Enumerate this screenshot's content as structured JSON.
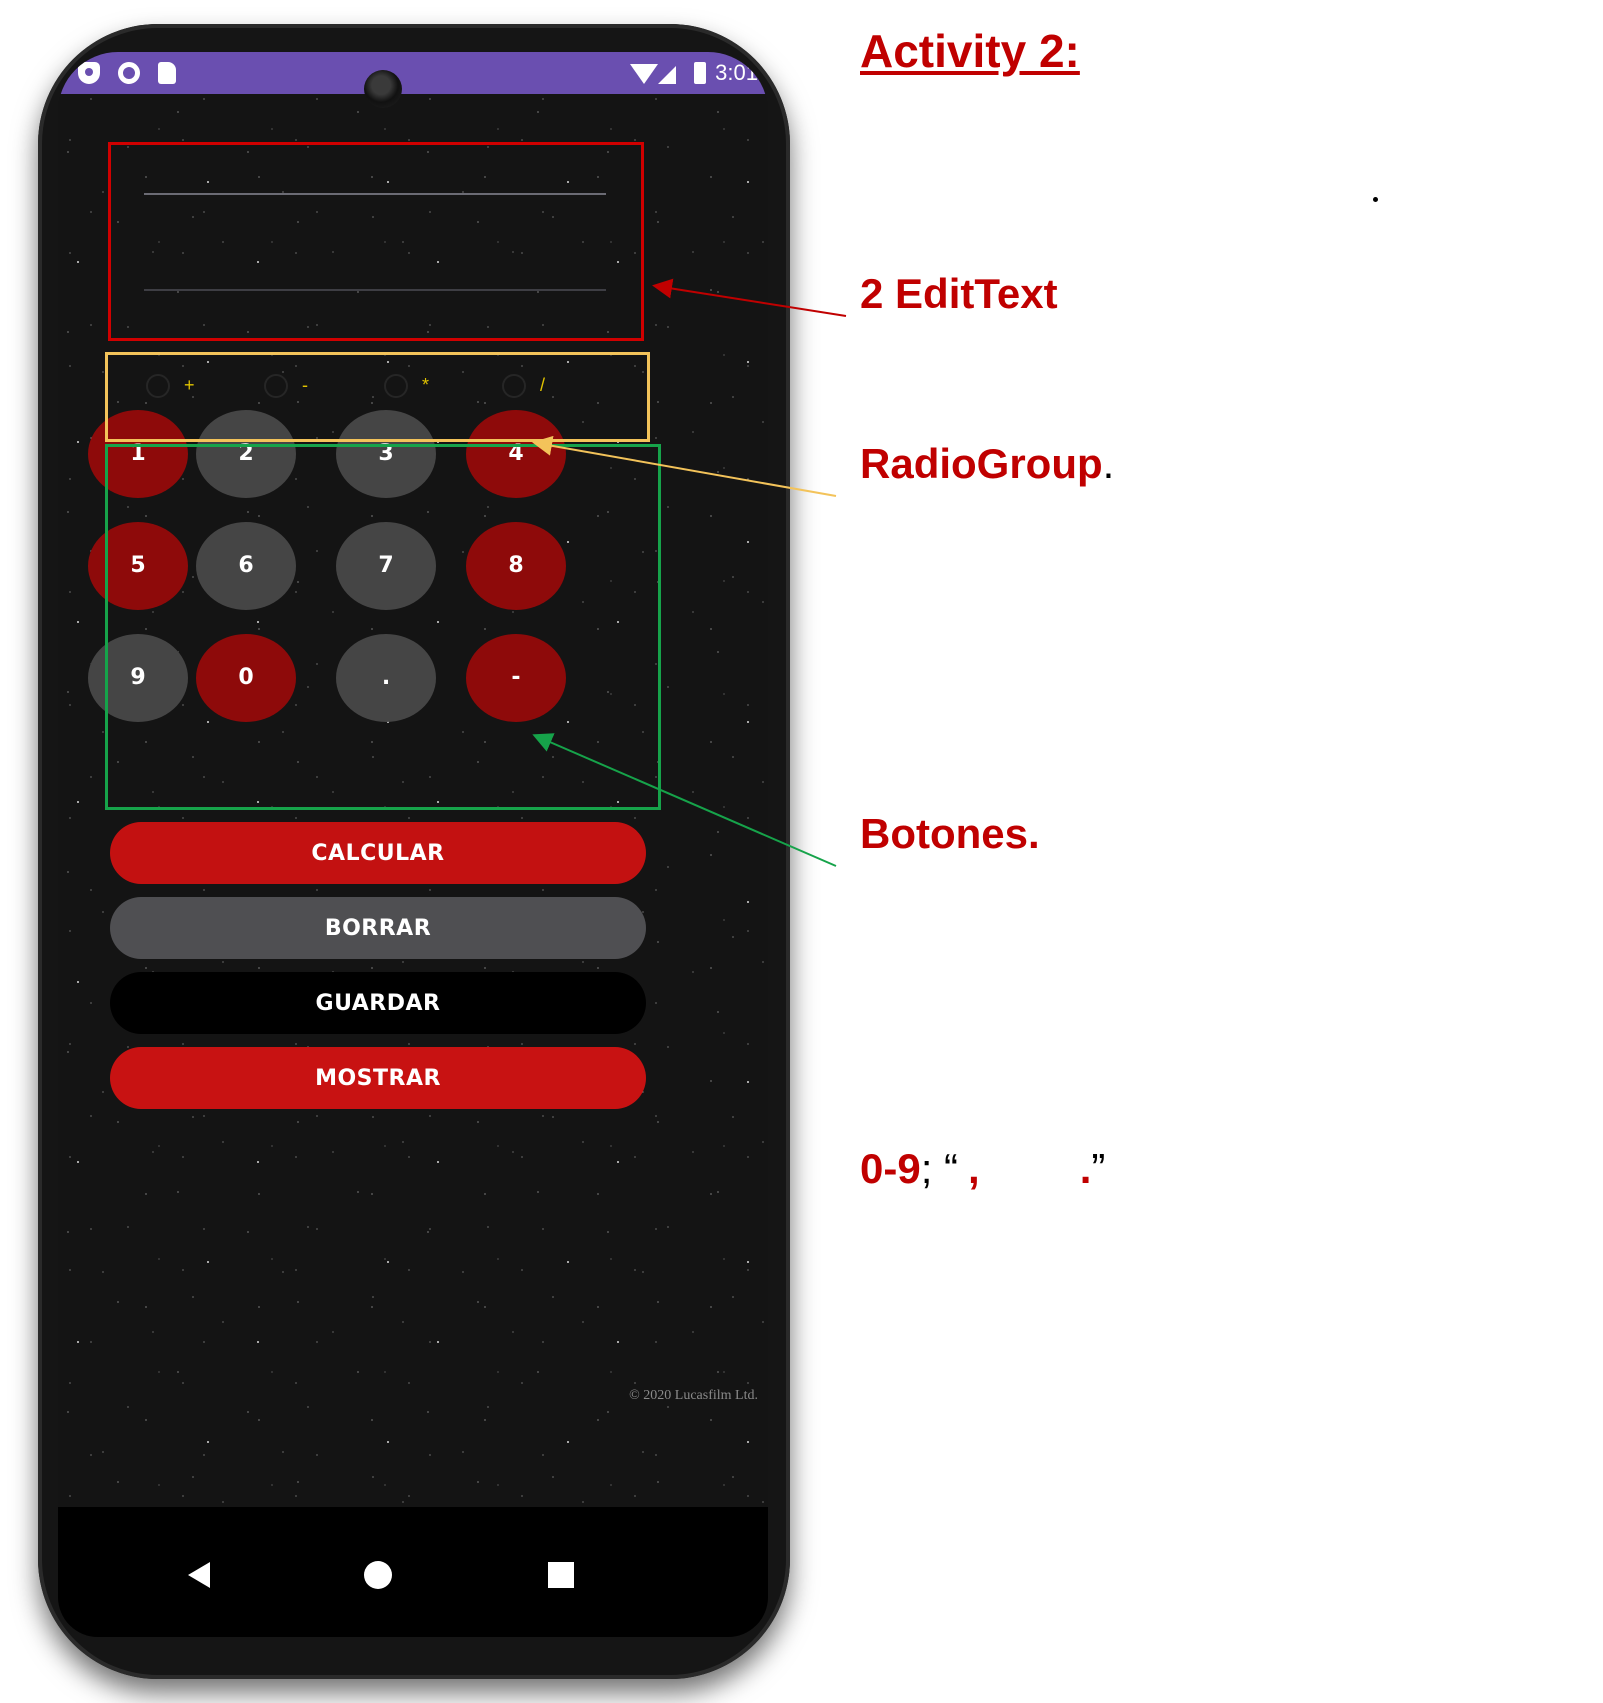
{
  "annotations": {
    "title": "Activity 2:",
    "edittext_label": "2 EditText",
    "radiogroup_label": "RadioGroup",
    "radiogroup_suffix": ".",
    "buttons_label": "Botones.",
    "digits_label": "0-9",
    "digits_sep": "; “",
    "digits_comma": ",",
    "digits_dot": ".",
    "digits_close": "”"
  },
  "statusbar": {
    "time": "3:01"
  },
  "radio_options": [
    "+",
    "-",
    "*",
    "/"
  ],
  "keypad": [
    {
      "label": "1",
      "color": "red"
    },
    {
      "label": "2",
      "color": "grey"
    },
    {
      "label": "3",
      "color": "grey"
    },
    {
      "label": "4",
      "color": "red"
    },
    {
      "label": "5",
      "color": "red"
    },
    {
      "label": "6",
      "color": "grey"
    },
    {
      "label": "7",
      "color": "grey"
    },
    {
      "label": "8",
      "color": "red"
    },
    {
      "label": "9",
      "color": "grey"
    },
    {
      "label": "0",
      "color": "red"
    },
    {
      "label": ".",
      "color": "grey"
    },
    {
      "label": "-",
      "color": "red"
    }
  ],
  "actions": {
    "calcular": "CALCULAR",
    "borrar": "BORRAR",
    "guardar": "GUARDAR",
    "mostrar": "MOSTRAR"
  },
  "watermark": "© 2020 Lucasfilm Ltd.",
  "colors": {
    "statusbar": "#6a4fb0",
    "annotation_red": "#c00000",
    "edittext_box": "#d00000",
    "radiogroup_box": "#f3c35a",
    "buttons_box": "#16a34a",
    "button_red": "#8e0a0a",
    "button_grey": "#454545"
  }
}
